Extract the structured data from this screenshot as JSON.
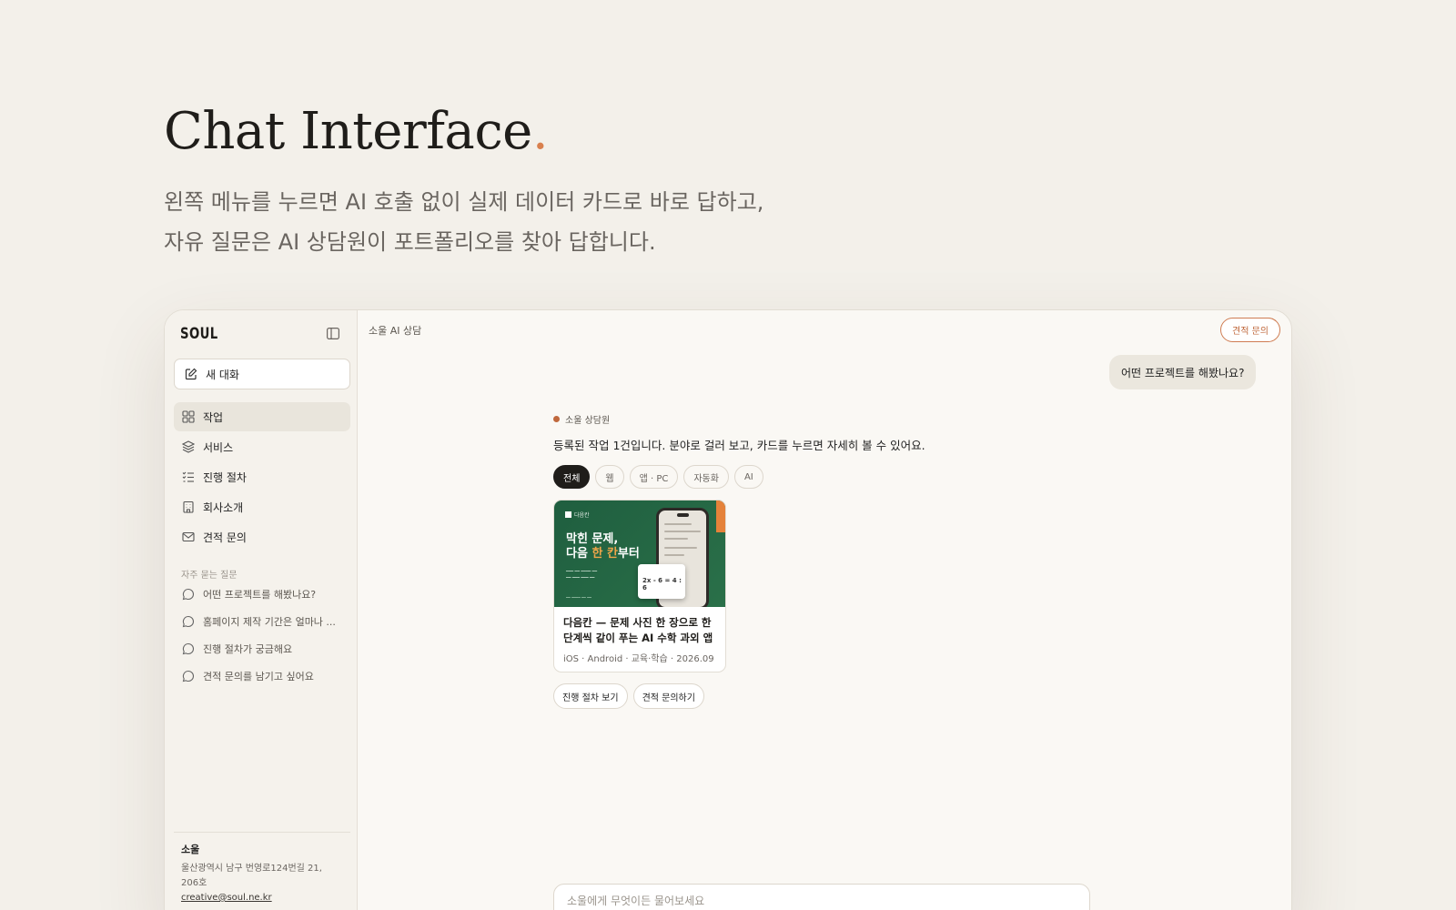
{
  "hero": {
    "title": "Chat Interface",
    "title_dot": ".",
    "subtitle_line1": "왼쪽 메뉴를 누르면 AI 호출 없이 실제 데이터 카드로 바로 답하고,",
    "subtitle_line2": "자유 질문은 AI 상담원이 포트폴리오를 찾아 답합니다."
  },
  "sidebar": {
    "logo": "SOUL",
    "new_chat_label": "새 대화",
    "nav": [
      {
        "label": "작업",
        "icon": "grid-icon",
        "active": true
      },
      {
        "label": "서비스",
        "icon": "layers-icon"
      },
      {
        "label": "진행 절차",
        "icon": "checklist-icon"
      },
      {
        "label": "회사소개",
        "icon": "building-icon"
      },
      {
        "label": "견적 문의",
        "icon": "mail-icon"
      }
    ],
    "faq_header": "자주 묻는 질문",
    "faq": [
      {
        "label": "어떤 프로젝트를 해봤나요?"
      },
      {
        "label": "홈페이지 제작 기간은 얼마나 ..."
      },
      {
        "label": "진행 절차가 궁금해요"
      },
      {
        "label": "견적 문의를 남기고 싶어요"
      }
    ],
    "footer": {
      "name": "소울",
      "address_line1": "울산광역시 남구 번영로124번길 21,",
      "address_line2": "206호",
      "email": "creative@soul.ne.kr"
    }
  },
  "main": {
    "topbar_title": "소울 AI 상담",
    "quote_button": "견적 문의",
    "user_message": "어떤 프로젝트를 해봤나요?",
    "assistant_label": "소울 상담원",
    "assistant_text": "등록된 작업 1건입니다. 분야로 걸러 보고, 카드를 누르면 자세히 볼 수 있어요.",
    "filters": [
      {
        "label": "전체",
        "active": true
      },
      {
        "label": "웹"
      },
      {
        "label": "앱 · PC"
      },
      {
        "label": "자동화"
      },
      {
        "label": "AI"
      }
    ],
    "card": {
      "thumb_brand": "다음칸",
      "thumb_headline_1": "막힌 문제,",
      "thumb_headline_2a": "다음 ",
      "thumb_headline_2b": "한 칸",
      "thumb_headline_2c": "부터",
      "thumb_equation": "2x - 6 = 4 : 6",
      "title": "다음칸 — 문제 사진 한 장으로 한 단계씩 같이 푸는 AI 수학 과외 앱",
      "meta": "iOS · Android · 교육·학습 · 2026.09"
    },
    "actions": [
      {
        "label": "진행 절차 보기"
      },
      {
        "label": "견적 문의하기"
      }
    ],
    "composer_placeholder": "소울에게 무엇이든 물어보세요"
  },
  "colors": {
    "accent": "#d9804e",
    "background": "#f3f0ea",
    "card_green": "#1f5e3f",
    "highlight_orange": "#f0a64a"
  }
}
